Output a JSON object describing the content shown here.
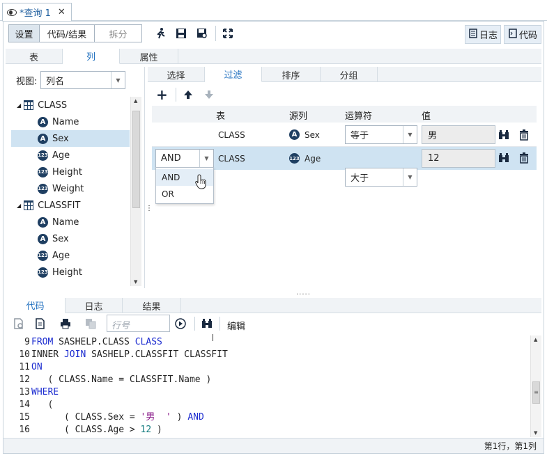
{
  "doc_tab": {
    "label": "*查询 1",
    "close": "✕"
  },
  "toolbar": {
    "settings": "设置",
    "code_results": "代码/结果",
    "split": "拆分",
    "log_button": "日志",
    "code_button": "代码"
  },
  "main_tabs": [
    "表",
    "列",
    "属性"
  ],
  "view": {
    "label": "视图:",
    "value": "列名"
  },
  "tree": {
    "tables": [
      {
        "name": "CLASS",
        "columns": [
          {
            "name": "Name",
            "type": "A"
          },
          {
            "name": "Sex",
            "type": "A"
          },
          {
            "name": "Age",
            "type": "123"
          },
          {
            "name": "Height",
            "type": "123"
          },
          {
            "name": "Weight",
            "type": "123"
          }
        ]
      },
      {
        "name": "CLASSFIT",
        "columns": [
          {
            "name": "Name",
            "type": "A"
          },
          {
            "name": "Sex",
            "type": "A"
          },
          {
            "name": "Age",
            "type": "123"
          },
          {
            "name": "Height",
            "type": "123"
          }
        ]
      }
    ]
  },
  "query_tabs": [
    "选择",
    "过滤",
    "排序",
    "分组"
  ],
  "filter": {
    "headers": {
      "table": "表",
      "source": "源列",
      "operator": "运算符",
      "value": "值"
    },
    "rows": [
      {
        "logic": "",
        "table": "CLASS",
        "source_type": "A",
        "source": "Sex",
        "operator": "等于",
        "value": "男"
      },
      {
        "logic": "AND",
        "table": "CLASS",
        "source_type": "123",
        "source": "Age",
        "operator": "大于",
        "value": "12"
      }
    ],
    "logic_options": [
      "AND",
      "OR"
    ]
  },
  "bottom_tabs": [
    "代码",
    "日志",
    "结果"
  ],
  "code_toolbar": {
    "line_placeholder": "行号",
    "edit": "编辑"
  },
  "code_lines": [
    {
      "n": "9",
      "parts": [
        [
          "kw",
          "FROM"
        ],
        [
          "t",
          " SASHELP.CLASS "
        ],
        [
          "kw",
          "CLASS"
        ]
      ]
    },
    {
      "n": "10",
      "parts": [
        [
          "t",
          "INNER "
        ],
        [
          "kw",
          "JOIN"
        ],
        [
          "t",
          " SASHELP.CLASSFIT CLASSFIT"
        ]
      ]
    },
    {
      "n": "11",
      "parts": [
        [
          "kw",
          "ON"
        ]
      ]
    },
    {
      "n": "12",
      "parts": [
        [
          "t",
          "   ( CLASS.Name = CLASSFIT.Name )"
        ]
      ]
    },
    {
      "n": "13",
      "parts": [
        [
          "kw",
          "WHERE"
        ]
      ]
    },
    {
      "n": "14",
      "parts": [
        [
          "t",
          "   ("
        ]
      ]
    },
    {
      "n": "15",
      "parts": [
        [
          "t",
          "      ( CLASS.Sex = "
        ],
        [
          "str",
          "'男  '"
        ],
        [
          "t",
          " ) "
        ],
        [
          "kw",
          "AND"
        ]
      ]
    },
    {
      "n": "16",
      "parts": [
        [
          "t",
          "      ( CLASS.Age > "
        ],
        [
          "num",
          "12"
        ],
        [
          "t",
          " )"
        ]
      ]
    }
  ],
  "status": "第1行，第1列",
  "colors": {
    "accent": "#1f6fbf",
    "selected_row": "#cfe3f2",
    "keyword": "#1c2cd0"
  }
}
